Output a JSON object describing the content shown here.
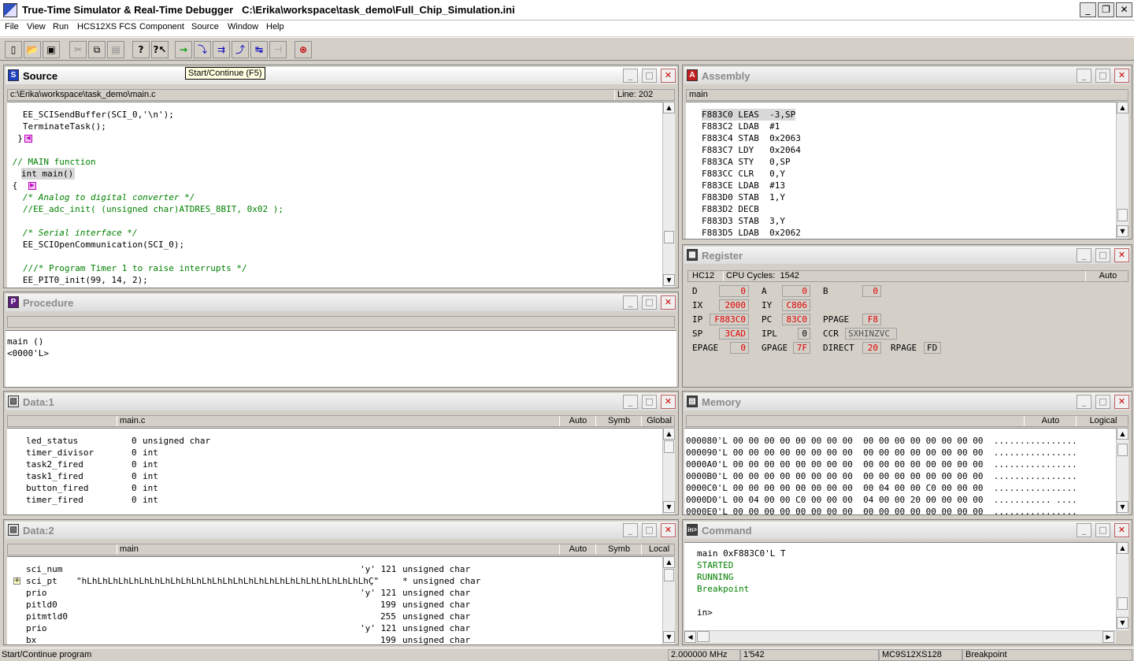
{
  "window": {
    "title": "True-Time Simulator & Real-Time Debugger   C:\\Erika\\workspace\\task_demo\\Full_Chip_Simulation.ini"
  },
  "menu": [
    "File",
    "View",
    "Run",
    "HCS12XS FCS",
    "Component",
    "Source",
    "Window",
    "Help"
  ],
  "tooltip": "Start/Continue (F5)",
  "source": {
    "title": "Source",
    "path": "c:\\Erika\\workspace\\task_demo\\main.c",
    "line": "Line: 202",
    "lines": [
      "   EE_SCISendBuffer(SCI_0,'\\n');",
      "   TerminateTask();",
      "  }",
      "",
      " // MAIN function",
      " int main()",
      " {",
      "   /* Analog to digital converter */",
      "   //EE_adc_init( (unsigned char)ATDRES_8BIT, 0x02 );",
      "",
      "   /* Serial interface */",
      "   EE_SCIOpenCommunication(SCI_0);",
      "",
      "   ///* Program Timer 1 to raise interrupts */",
      "   EE_PIT0_init(99, 14, 2);"
    ]
  },
  "procedure": {
    "title": "Procedure",
    "lines": [
      "main ()",
      "<0000'L>"
    ]
  },
  "assembly": {
    "title": "Assembly",
    "header": "main",
    "lines": [
      "F883C0 LEAS  -3,SP",
      "F883C2 LDAB  #1",
      "F883C4 STAB  0x2063",
      "F883C7 LDY   0x2064",
      "F883CA STY   0,SP",
      "F883CC CLR   0,Y",
      "F883CE LDAB  #13",
      "F883D0 STAB  1,Y",
      "F883D2 DECB",
      "F883D3 STAB  3,Y",
      "F883D5 LDAB  0x2062"
    ]
  },
  "register": {
    "title": "Register",
    "cpu": "HC12",
    "cycles": "CPU Cycles:  1542",
    "mode": "Auto",
    "regs": [
      {
        "n": "D",
        "v": "0"
      },
      {
        "n": "A",
        "v": "0"
      },
      {
        "n": "B",
        "v": "0"
      },
      {
        "n": "IX",
        "v": "2000"
      },
      {
        "n": "IY",
        "v": "C806"
      },
      {
        "n": "IP",
        "v": "F883C0"
      },
      {
        "n": "PC",
        "v": "83C0"
      },
      {
        "n": "PPAGE",
        "v": "F8"
      },
      {
        "n": "SP",
        "v": "3CAD"
      },
      {
        "n": "IPL",
        "v": "0"
      },
      {
        "n": "CCR",
        "v": "SXHINZVC"
      },
      {
        "n": "EPAGE",
        "v": "0"
      },
      {
        "n": "GPAGE",
        "v": "7F"
      },
      {
        "n": "DIRECT",
        "v": "20"
      },
      {
        "n": "RPAGE",
        "v": "FD"
      }
    ]
  },
  "data1": {
    "title": "Data:1",
    "file": "main.c",
    "auto": "Auto",
    "symb": "Symb",
    "scope": "Global",
    "rows": [
      {
        "name": "led_status",
        "val": "0",
        "type": "unsigned char"
      },
      {
        "name": "timer_divisor",
        "val": "0",
        "type": "int"
      },
      {
        "name": "task2_fired",
        "val": "0",
        "type": "int"
      },
      {
        "name": "task1_fired",
        "val": "0",
        "type": "int"
      },
      {
        "name": "button_fired",
        "val": "0",
        "type": "int"
      },
      {
        "name": "timer_fired",
        "val": "0",
        "type": "int"
      }
    ]
  },
  "memory": {
    "title": "Memory",
    "auto": "Auto",
    "mode": "Logical",
    "lines": [
      "000080'L 00 00 00 00 00 00 00 00  00 00 00 00 00 00 00 00  ................",
      "000090'L 00 00 00 00 00 00 00 00  00 00 00 00 00 00 00 00  ................",
      "0000A0'L 00 00 00 00 00 00 00 00  00 00 00 00 00 00 00 00  ................",
      "0000B0'L 00 00 00 00 00 00 00 00  00 00 00 00 00 00 00 00  ................",
      "0000C0'L 00 00 00 00 00 00 00 00  00 04 00 00 C0 00 00 00  ................",
      "0000D0'L 00 04 00 00 C0 00 00 00  04 00 00 20 00 00 00 00  ........... ....",
      "0000E0'L 00 00 00 00 00 00 00 00  00 00 00 00 00 00 00 00  ................"
    ]
  },
  "data2": {
    "title": "Data:2",
    "file": "main",
    "auto": "Auto",
    "symb": "Symb",
    "scope": "Local",
    "rows": [
      {
        "name": "sci_num",
        "val": "'y' 121",
        "type": "unsigned char"
      },
      {
        "name": "sci_pt",
        "val": "\"hLhLhLhLhLhLhLhLhLhLhLhLhLhLhLhLhLhLhLhLhLhLhLhLhLhLhLhÇ\"",
        "type": "* unsigned char"
      },
      {
        "name": "prio",
        "val": "'y' 121",
        "type": "unsigned char"
      },
      {
        "name": "pitld0",
        "val": "199",
        "type": "unsigned char"
      },
      {
        "name": "pitmtld0",
        "val": "255",
        "type": "unsigned char"
      },
      {
        "name": "prio",
        "val": "'y' 121",
        "type": "unsigned char"
      },
      {
        "name": "bx",
        "val": "199",
        "type": "unsigned char"
      }
    ]
  },
  "command": {
    "title": "Command",
    "lines": [
      {
        "t": "main 0xF883C0'L T",
        "c": "black"
      },
      {
        "t": "STARTED",
        "c": "green"
      },
      {
        "t": "RUNNING",
        "c": "green"
      },
      {
        "t": "Breakpoint",
        "c": "green"
      },
      {
        "t": "",
        "c": "black"
      },
      {
        "t": "in>",
        "c": "black"
      }
    ]
  },
  "status": {
    "message": "Start/Continue program",
    "freq": "2.000000 MHz",
    "cycles": "1'542",
    "chip": "MC9S12XS128",
    "state": "Breakpoint"
  },
  "colors": {
    "red": "#e00000",
    "green": "#008000",
    "highlight": "#d4d0c8"
  }
}
